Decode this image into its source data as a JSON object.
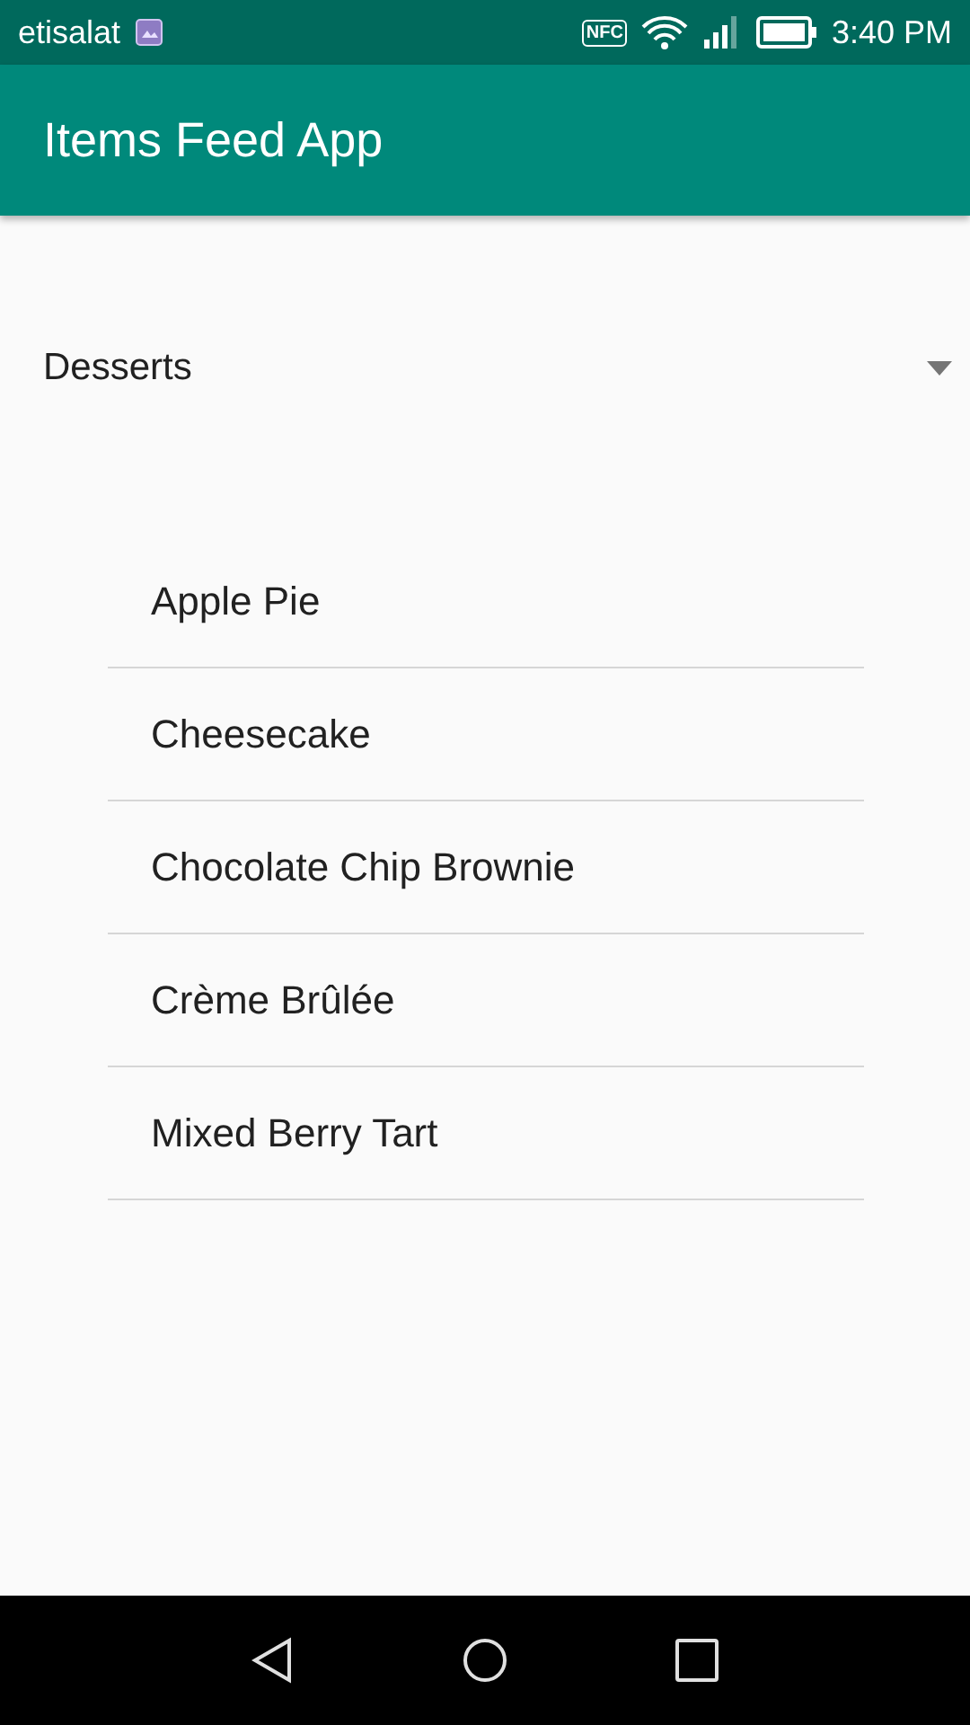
{
  "status_bar": {
    "carrier": "etisalat",
    "nfc_badge": "NFC",
    "time": "3:40 PM"
  },
  "app_bar": {
    "title": "Items Feed App"
  },
  "category_dropdown": {
    "value": "Desserts"
  },
  "items": [
    {
      "label": "Apple Pie"
    },
    {
      "label": "Cheesecake"
    },
    {
      "label": "Chocolate Chip Brownie"
    },
    {
      "label": "Crème Brûlée"
    },
    {
      "label": "Mixed Berry Tart"
    }
  ]
}
